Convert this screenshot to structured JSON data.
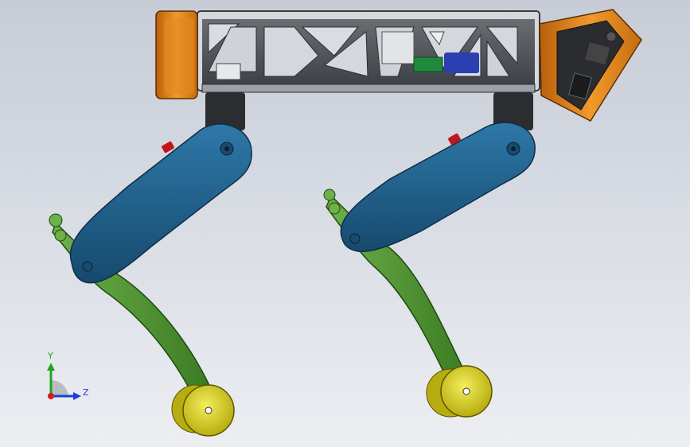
{
  "app": {
    "window_title": ""
  },
  "triad": {
    "y_label": "Y",
    "z_label": "Z",
    "y_color": "#1fa61f",
    "z_color": "#1b3fd6",
    "x_color": "#d81b1b"
  },
  "model": {
    "frame_color": "#55585c",
    "frame_light": "#c9cbcf",
    "bracket_color": "#d97a16",
    "upper_leg_color": "#1f5c86",
    "lower_leg_color": "#4d8f2f",
    "foot_color": "#d8d21f",
    "motor_color": "#2b2d30",
    "button_color": "#c0161c",
    "pcb_color": "#1f8a3b",
    "battery_color": "#2b3fb0"
  }
}
